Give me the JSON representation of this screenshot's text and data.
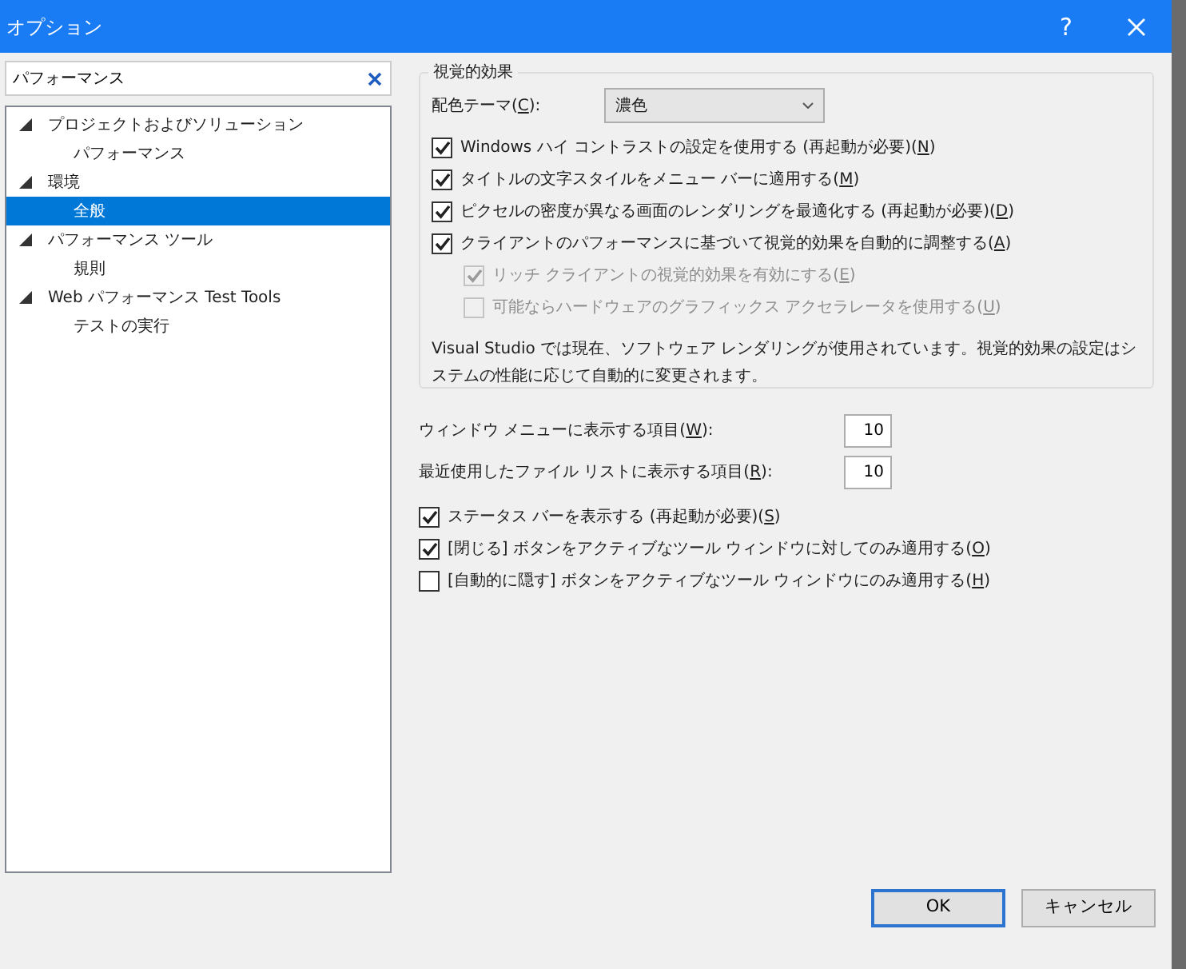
{
  "window": {
    "title": "オプション",
    "help": "?"
  },
  "search": {
    "value": "パフォーマンス"
  },
  "tree": [
    {
      "label": "プロジェクトおよびソリューション",
      "expanded": true,
      "selected": false,
      "children": [
        {
          "label": "パフォーマンス",
          "selected": false
        }
      ]
    },
    {
      "label": "環境",
      "expanded": true,
      "selected": false,
      "children": [
        {
          "label": "全般",
          "selected": true
        }
      ]
    },
    {
      "label": "パフォーマンス ツール",
      "expanded": true,
      "selected": false,
      "children": [
        {
          "label": "規則",
          "selected": false
        }
      ]
    },
    {
      "label": "Web パフォーマンス Test Tools",
      "expanded": true,
      "selected": false,
      "children": [
        {
          "label": "テストの実行",
          "selected": false
        }
      ]
    }
  ],
  "visual_effects": {
    "title": "視覚的効果",
    "theme": {
      "text": "配色テーマ(",
      "key": "C",
      "tail": "):",
      "value": "濃色"
    },
    "options": [
      {
        "text": "Windows ハイ コントラストの設定を使用する (再起動が必要)(",
        "key": "N",
        "tail": ")",
        "checked": true,
        "disabled": false,
        "indented": false
      },
      {
        "text": "タイトルの文字スタイルをメニュー バーに適用する(",
        "key": "M",
        "tail": ")",
        "checked": true,
        "disabled": false,
        "indented": false
      },
      {
        "text": "ピクセルの密度が異なる画面のレンダリングを最適化する (再起動が必要)(",
        "key": "D",
        "tail": ")",
        "checked": true,
        "disabled": false,
        "indented": false
      },
      {
        "text": "クライアントのパフォーマンスに基づいて視覚的効果を自動的に調整する(",
        "key": "A",
        "tail": ")",
        "checked": true,
        "disabled": false,
        "indented": false
      },
      {
        "text": "リッチ クライアントの視覚的効果を有効にする(",
        "key": "E",
        "tail": ")",
        "checked": true,
        "disabled": true,
        "indented": true
      },
      {
        "text": "可能ならハードウェアのグラフィックス アクセラレータを使用する(",
        "key": "U",
        "tail": ")",
        "checked": false,
        "disabled": true,
        "indented": true
      }
    ],
    "note": "Visual Studio では現在、ソフトウェア レンダリングが使用されています。視覚的効果の設定はシステムの性能に応じて自動的に変更されます。"
  },
  "counts": [
    {
      "text": "ウィンドウ メニューに表示する項目(",
      "key": "W",
      "tail": "):",
      "value": "10"
    },
    {
      "text": "最近使用したファイル リストに表示する項目(",
      "key": "R",
      "tail": "):",
      "value": "10"
    }
  ],
  "options": [
    {
      "text": "ステータス バーを表示する (再起動が必要)(",
      "key": "S",
      "tail": ")",
      "checked": true
    },
    {
      "text": "[閉じる] ボタンをアクティブなツール ウィンドウに対してのみ適用する(",
      "key": "O",
      "tail": ")",
      "checked": true
    },
    {
      "text": "[自動的に隠す] ボタンをアクティブなツール ウィンドウにのみ適用する(",
      "key": "H",
      "tail": ")",
      "checked": false
    }
  ],
  "buttons": [
    {
      "label": "OK",
      "default": true
    },
    {
      "label": "キャンセル",
      "default": false
    }
  ]
}
